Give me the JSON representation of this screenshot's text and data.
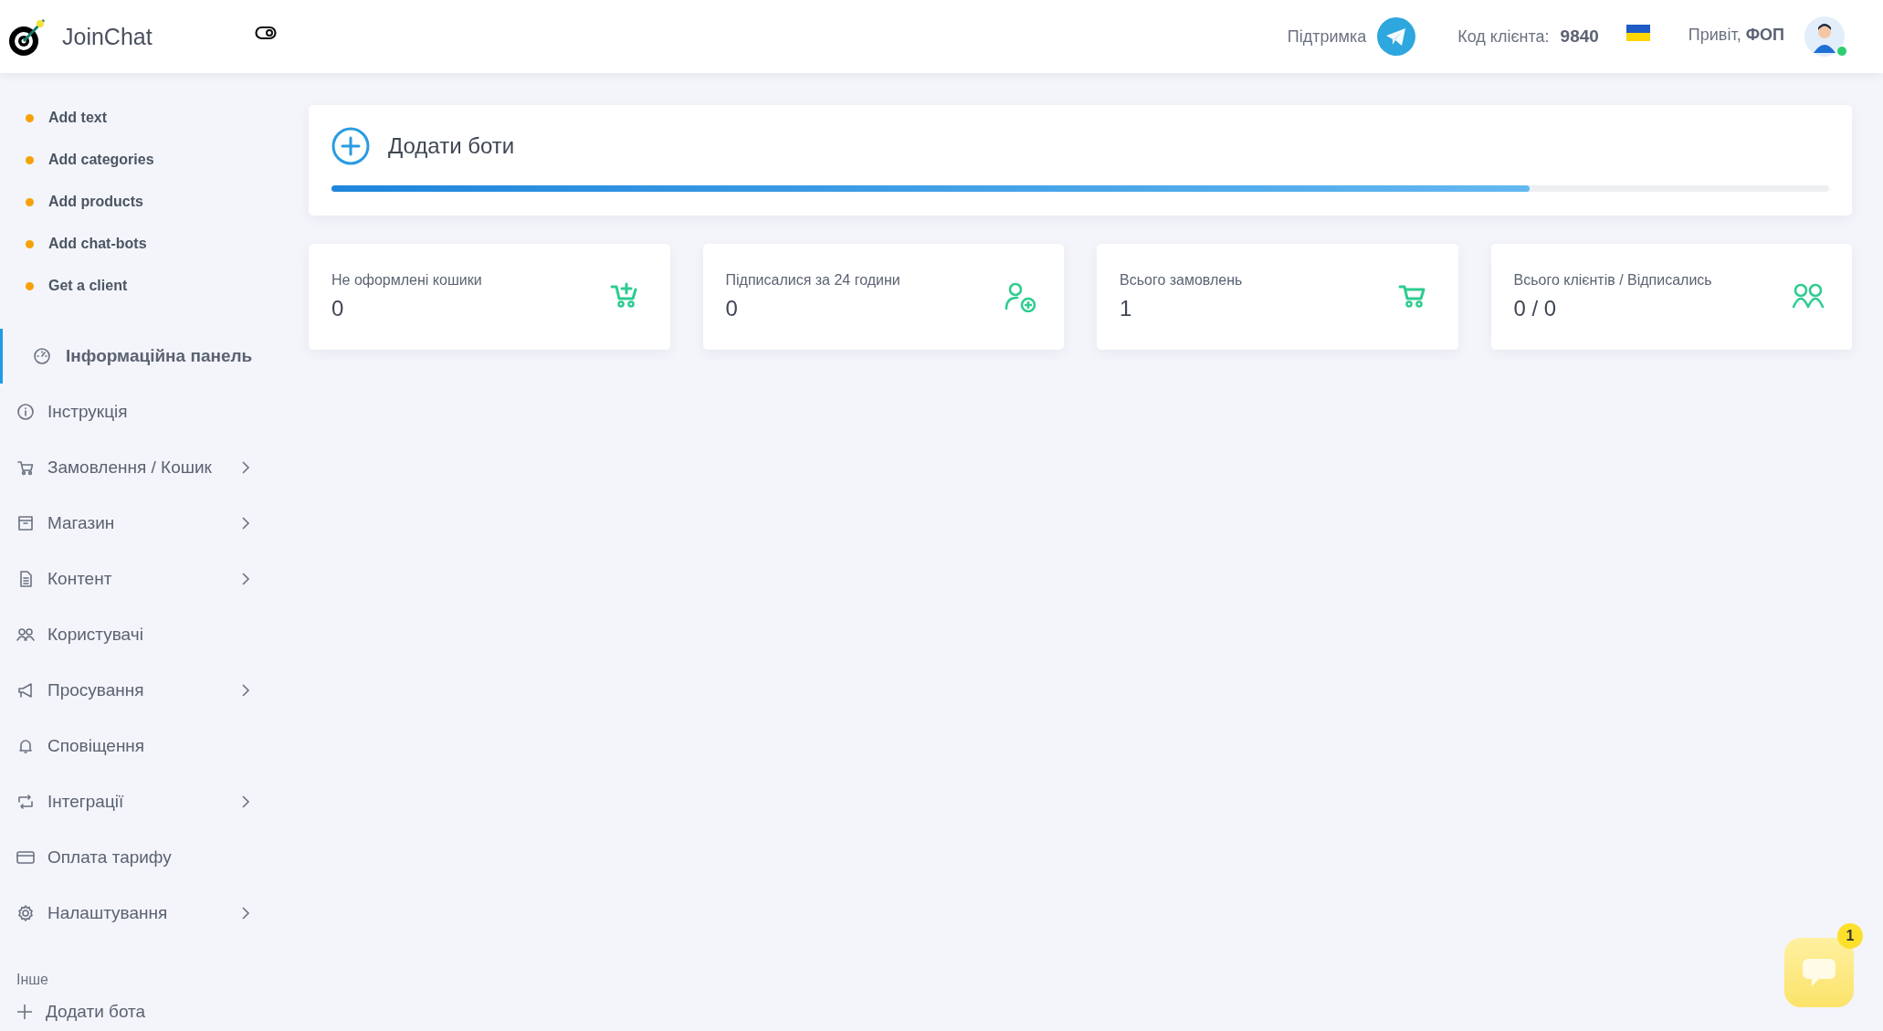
{
  "header": {
    "brand": "JoinChat",
    "support_label": "Підтримка",
    "client_code_label": "Код клієнта:",
    "client_code": "9840",
    "greeting": "Привіт, **ФОП**",
    "user_online": true
  },
  "checklist": [
    {
      "label": "Add text"
    },
    {
      "label": "Add categories"
    },
    {
      "label": "Add products"
    },
    {
      "label": "Add chat-bots"
    },
    {
      "label": "Get a client"
    }
  ],
  "sidebar": {
    "items": [
      {
        "label": "Інформаційна панель",
        "selected": true,
        "expandable": false
      },
      {
        "label": "Інструкція",
        "selected": false,
        "expandable": false
      },
      {
        "label": "Замовлення / Кошик",
        "selected": false,
        "expandable": true
      },
      {
        "label": "Магазин",
        "selected": false,
        "expandable": true
      },
      {
        "label": "Контент",
        "selected": false,
        "expandable": true
      },
      {
        "label": "Користувачі",
        "selected": false,
        "expandable": false
      },
      {
        "label": "Просування",
        "selected": false,
        "expandable": true
      },
      {
        "label": "Сповіщення",
        "selected": false,
        "expandable": false
      },
      {
        "label": "Інтеграції",
        "selected": false,
        "expandable": true
      },
      {
        "label": "Оплата тарифу",
        "selected": false,
        "expandable": false
      },
      {
        "label": "Налаштування",
        "selected": false,
        "expandable": true
      }
    ],
    "section_title": "Інше",
    "extra_items": [
      {
        "label": "Додати бота"
      }
    ]
  },
  "add_bots": {
    "title": "Додати боти",
    "level": 0.8
  },
  "stats": [
    {
      "label": "Не оформлені кошики",
      "value": "0"
    },
    {
      "label": "Підписалися за 24 години",
      "value": "0"
    },
    {
      "label": "Всього замовлень",
      "value": "1"
    },
    {
      "label": "Всього клієнтів / Відписались",
      "value": "0 / 0"
    }
  ],
  "chat_widget": {
    "badge": "1"
  }
}
